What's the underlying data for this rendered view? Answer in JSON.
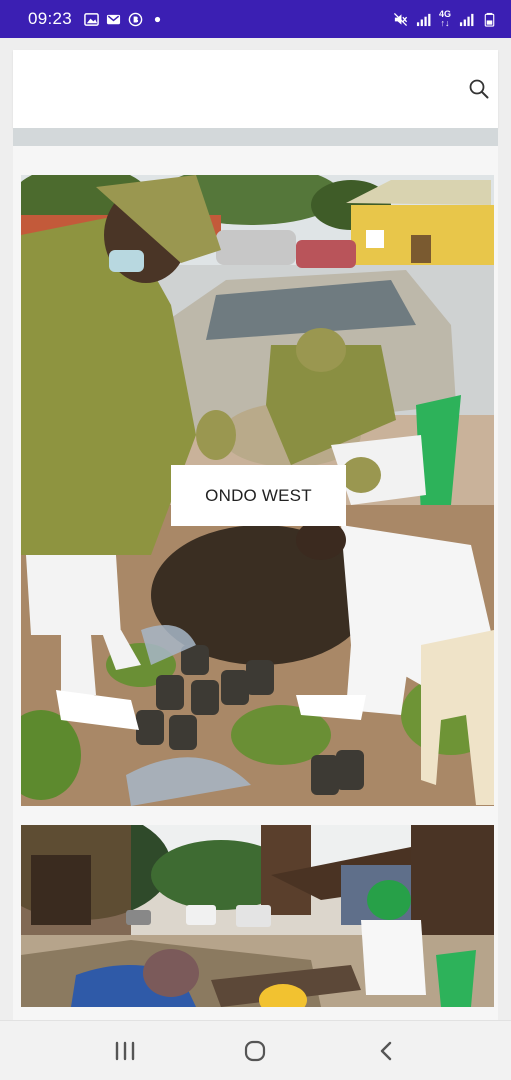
{
  "status_bar": {
    "time": "09:23",
    "network_label_top": "4G",
    "network_label_bottom": "↑↓"
  },
  "icons": {
    "search": "search-icon",
    "recents": "recents-icon",
    "home": "home-icon",
    "back": "back-icon"
  },
  "posts": [
    {
      "label": "ONDO WEST"
    }
  ],
  "colors": {
    "status_bar_bg": "#3b1fb3",
    "uniform_khaki": "#8e9440",
    "page_bg": "#eeeeee"
  }
}
